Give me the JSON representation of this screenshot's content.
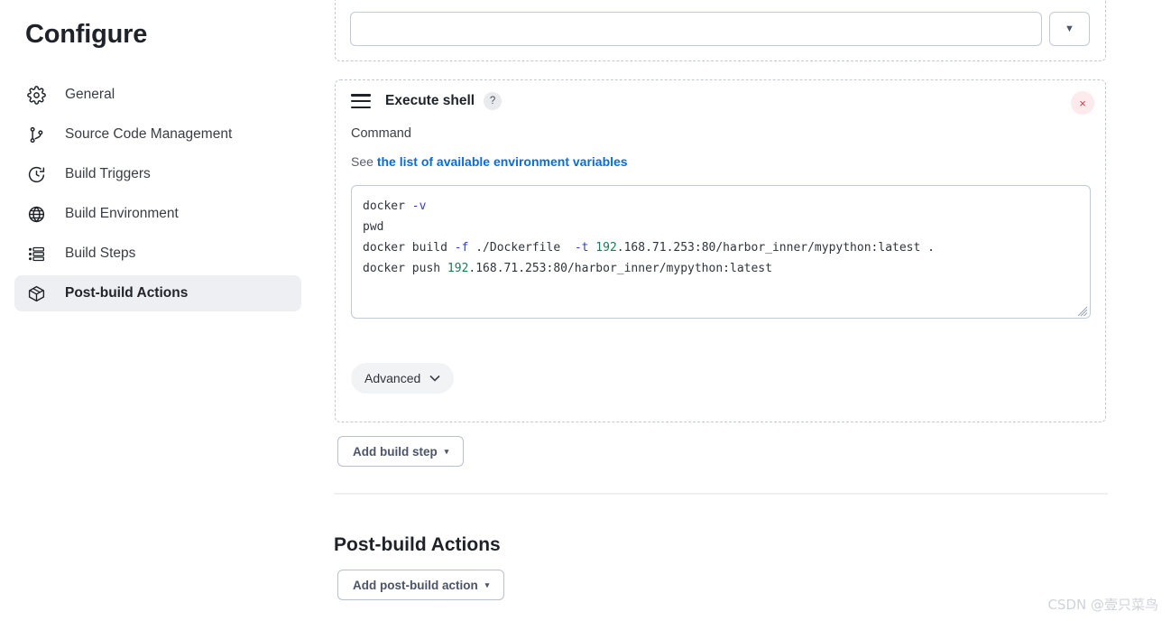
{
  "page": {
    "title": "Configure",
    "watermark": "CSDN @壹只菜鸟"
  },
  "sidebar": {
    "items": [
      {
        "label": "General",
        "icon": "gear-icon",
        "active": false
      },
      {
        "label": "Source Code Management",
        "icon": "git-branch-icon",
        "active": false
      },
      {
        "label": "Build Triggers",
        "icon": "clock-icon",
        "active": false
      },
      {
        "label": "Build Environment",
        "icon": "globe-icon",
        "active": false
      },
      {
        "label": "Build Steps",
        "icon": "list-icon",
        "active": false
      },
      {
        "label": "Post-build Actions",
        "icon": "package-icon",
        "active": true
      }
    ]
  },
  "top_panel": {
    "select_value": "",
    "select_placeholder": "",
    "caret_icon": "chevron-down-icon"
  },
  "build_step": {
    "drag_handle_icon": "drag-handle-icon",
    "title": "Execute shell",
    "help_icon": "?",
    "close_icon": "×",
    "command_label": "Command",
    "env_prefix": "See ",
    "env_link": "the list of available environment variables",
    "advanced_label": "Advanced",
    "advanced_caret_icon": "chevron-down-icon",
    "command_lines": [
      [
        {
          "t": "docker ",
          "c": "plain"
        },
        {
          "t": "-v",
          "c": "flag"
        }
      ],
      [
        {
          "t": "pwd",
          "c": "plain"
        }
      ],
      [
        {
          "t": "docker build ",
          "c": "plain"
        },
        {
          "t": "-f",
          "c": "flag"
        },
        {
          "t": " ./Dockerfile  ",
          "c": "plain"
        },
        {
          "t": "-t",
          "c": "flag"
        },
        {
          "t": " ",
          "c": "plain"
        },
        {
          "t": "192",
          "c": "num"
        },
        {
          "t": ".168.71.253:80/harbor_inner/mypython:latest .",
          "c": "plain"
        }
      ],
      [
        {
          "t": "docker push ",
          "c": "plain"
        },
        {
          "t": "192",
          "c": "num"
        },
        {
          "t": ".168.71.253:80/harbor_inner/mypython:latest",
          "c": "plain"
        }
      ]
    ]
  },
  "actions": {
    "add_build_step": "Add build step",
    "add_build_step_caret": "▾",
    "post_build_heading": "Post-build Actions",
    "add_post_build_action": "Add post-build action",
    "add_post_build_caret": "▾"
  },
  "colors": {
    "link": "#0b6cd4",
    "close_red": "#d93b4a",
    "close_bg": "#fdeaec",
    "active_nav_bg": "#eeeff2",
    "code_flag": "#2f41c8",
    "code_number": "#1c7a56",
    "dashed_border": "#c3c9d4"
  }
}
